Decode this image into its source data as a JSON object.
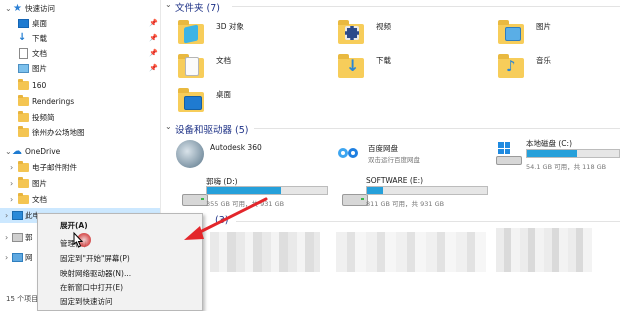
{
  "sidebar": {
    "quick_access": {
      "label": "快速访问"
    },
    "items": [
      {
        "label": "桌面",
        "pinned": true,
        "icon": "desktop-icon"
      },
      {
        "label": "下载",
        "pinned": true,
        "icon": "download-icon"
      },
      {
        "label": "文档",
        "pinned": true,
        "icon": "document-icon"
      },
      {
        "label": "图片",
        "pinned": true,
        "icon": "picture-icon"
      },
      {
        "label": "160",
        "pinned": false,
        "icon": "folder-icon"
      },
      {
        "label": "Renderings",
        "pinned": false,
        "icon": "folder-icon"
      },
      {
        "label": "投频简",
        "pinned": false,
        "icon": "folder-icon"
      },
      {
        "label": "徐州办公场地图",
        "pinned": false,
        "icon": "folder-icon"
      }
    ],
    "onedrive": {
      "label": "OneDrive"
    },
    "onedrive_items": [
      {
        "label": "电子邮件附件"
      },
      {
        "label": "图片"
      },
      {
        "label": "文档"
      }
    ],
    "this_pc": {
      "label": "此电"
    },
    "net1": {
      "label": "郭"
    },
    "net2": {
      "label": "网"
    }
  },
  "main": {
    "folders_section": {
      "title": "文件夹 (7)"
    },
    "folders": [
      {
        "label": "3D 对象",
        "icon": "3d-objects-icon"
      },
      {
        "label": "视频",
        "icon": "video-folder-icon"
      },
      {
        "label": "图片",
        "icon": "picture-folder-icon"
      },
      {
        "label": "文档",
        "icon": "document-folder-icon"
      },
      {
        "label": "下载",
        "icon": "download-folder-icon"
      },
      {
        "label": "音乐",
        "icon": "music-folder-icon"
      },
      {
        "label": "桌面",
        "icon": "desktop-folder-icon"
      }
    ],
    "devices_section": {
      "title": "设备和驱动器 (5)"
    },
    "devices": [
      {
        "name": "Autodesk 360",
        "sub": "",
        "capacity": ""
      },
      {
        "name": "百度网盘",
        "sub": "双击运行百度网盘",
        "capacity": ""
      },
      {
        "name": "本地磁盘 (C:)",
        "sub": "",
        "capacity": "54.1 GB 可用，共 118 GB",
        "used_fraction": 0.54
      },
      {
        "name": "郭嗨 (D:)",
        "sub": "",
        "capacity": "355 GB 可用，共 931 GB",
        "used_fraction": 0.62
      },
      {
        "name": "SOFTWARE (E:)",
        "sub": "",
        "capacity": "811 GB 可用，共 931 GB",
        "used_fraction": 0.13
      }
    ],
    "third_section": {
      "title": "(3)"
    }
  },
  "context_menu": {
    "items": [
      {
        "label": "展开(A)",
        "bold": true
      },
      {
        "label": "管理(G)"
      },
      {
        "label": "固定到\"开始\"屏幕(P)"
      },
      {
        "label": "映射网络驱动器(N)..."
      },
      {
        "label": "在新窗口中打开(E)"
      },
      {
        "label": "固定到快速访问"
      }
    ]
  },
  "status_bar": {
    "count": "15 个项目"
  },
  "colors": {
    "accent": "#26a0da",
    "folder": "#f4c552",
    "arrow": "#e3262b",
    "section_title": "#1e3287"
  }
}
